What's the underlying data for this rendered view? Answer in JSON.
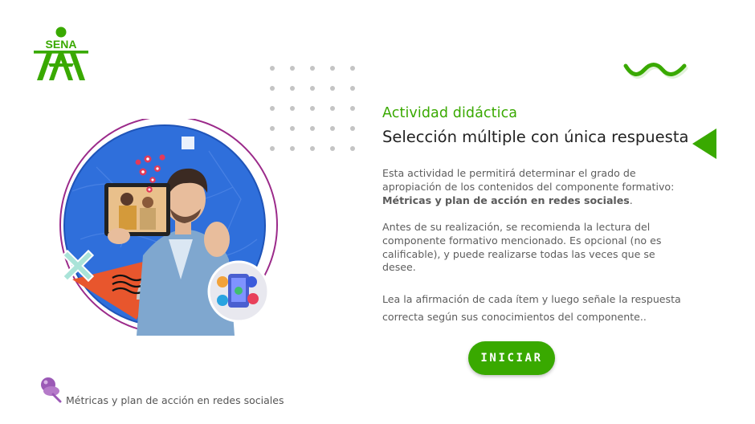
{
  "brand": {
    "logo_text": "SENA",
    "green": "#39a900",
    "purple": "#9b59b6"
  },
  "activity": {
    "subtitle": "Actividad didáctica",
    "title": "Selección múltiple con única respuesta",
    "intro": "Esta actividad le permitirá determinar el grado de apropiación de los contenidos del componente formativo:",
    "component_name": "Métricas y plan de acción en redes sociales",
    "intro_end": ".",
    "recommendation": "Antes de su realización, se recomienda la lectura del componente formativo mencionado.  Es opcional (no es calificable), y puede realizarse todas las veces que se desee.",
    "instructions": "Lea la afirmación de cada ítem y luego señale la respuesta correcta según sus conocimientos del componente.."
  },
  "actions": {
    "start_label": "INICIAR"
  },
  "footer": {
    "course_name": "Métricas y plan de acción en redes sociales"
  },
  "icons": {
    "logo": "sena-logo-icon",
    "nav": "triangle-left-icon",
    "decor_wave": "squiggle-icon",
    "decor_cross": "cross-icon",
    "footer": "pushpin-icon"
  }
}
